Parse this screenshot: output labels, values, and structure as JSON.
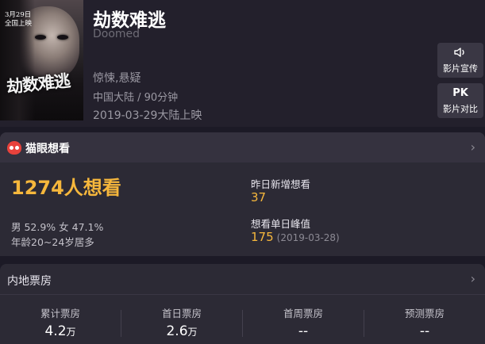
{
  "movie": {
    "title": "劫数难逃",
    "english_title": "Doomed",
    "genre": "惊悚,悬疑",
    "region_duration": "中国大陆 / 90分钟",
    "release": "2019-03-29大陆上映",
    "poster": {
      "date_note": "3月29日\n全国上映",
      "title_text": "劫数难逃"
    }
  },
  "side_buttons": {
    "promo": {
      "icon": "speaker-icon",
      "label": "影片宣传"
    },
    "pk": {
      "icon_text": "PK",
      "label": "影片对比"
    }
  },
  "want_panel": {
    "title": "猫眼想看",
    "total_want": "1274人想看",
    "gender": "男 52.9% 女 47.1%",
    "age": "年龄20~24岁居多",
    "new_label": "昨日新增想看",
    "new_value": "37",
    "peak_label": "想看单日峰值",
    "peak_value": "175",
    "peak_date": "(2019-03-28)"
  },
  "box_office": {
    "title": "内地票房",
    "items": [
      {
        "label": "累计票房",
        "value": "4.2",
        "unit": "万"
      },
      {
        "label": "首日票房",
        "value": "2.6",
        "unit": "万"
      },
      {
        "label": "首周票房",
        "value": "--",
        "unit": ""
      },
      {
        "label": "预测票房",
        "value": "--",
        "unit": ""
      }
    ]
  },
  "colors": {
    "background": "#1c1a26",
    "accent": "#f6b73c",
    "panel": "#2c2a35",
    "brand_red": "#e8423c"
  }
}
